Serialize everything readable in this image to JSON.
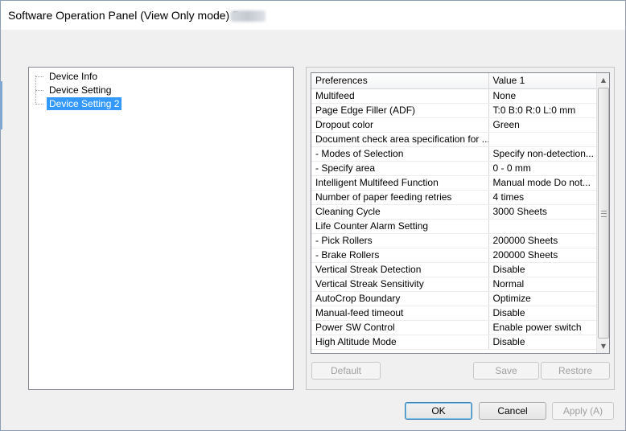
{
  "window": {
    "title": "Software Operation Panel (View Only mode) fi-"
  },
  "tree": {
    "items": [
      {
        "label": "Device Info"
      },
      {
        "label": "Device Setting"
      },
      {
        "label": "Device Setting 2"
      }
    ],
    "selected_index": 2
  },
  "grid": {
    "columns": [
      "Preferences",
      "Value 1"
    ],
    "rows": [
      {
        "name": "Multifeed",
        "value": "None"
      },
      {
        "name": "Page Edge Filler (ADF)",
        "value": "T:0  B:0  R:0  L:0 mm"
      },
      {
        "name": "Dropout color",
        "value": "Green"
      },
      {
        "name": "Document check area specification for ...",
        "value": ""
      },
      {
        "name": " - Modes of Selection",
        "value": "Specify non-detection..."
      },
      {
        "name": " - Specify area",
        "value": "0 - 0 mm"
      },
      {
        "name": "Intelligent Multifeed Function",
        "value": "Manual mode  Do not..."
      },
      {
        "name": "Number of paper feeding retries",
        "value": "4 times"
      },
      {
        "name": "Cleaning Cycle",
        "value": "3000 Sheets"
      },
      {
        "name": "Life Counter Alarm Setting",
        "value": ""
      },
      {
        "name": " - Pick Rollers",
        "value": "200000 Sheets"
      },
      {
        "name": " - Brake Rollers",
        "value": "200000 Sheets"
      },
      {
        "name": "Vertical Streak Detection",
        "value": "Disable"
      },
      {
        "name": "Vertical Streak Sensitivity",
        "value": "Normal"
      },
      {
        "name": "AutoCrop Boundary",
        "value": "Optimize"
      },
      {
        "name": "Manual-feed timeout",
        "value": "Disable"
      },
      {
        "name": "Power SW Control",
        "value": "Enable power switch"
      },
      {
        "name": "High Altitude Mode",
        "value": "Disable"
      }
    ]
  },
  "buttons": {
    "default_label": "Default",
    "save_label": "Save",
    "restore_label": "Restore",
    "ok_label": "OK",
    "cancel_label": "Cancel",
    "apply_label": "Apply (A)"
  },
  "icons": {
    "scroll_up": "scroll-up-arrow-icon",
    "scroll_down": "scroll-down-arrow-icon"
  },
  "colors": {
    "selection": "#3399ff",
    "dialog_bg": "#f0f0f0"
  }
}
